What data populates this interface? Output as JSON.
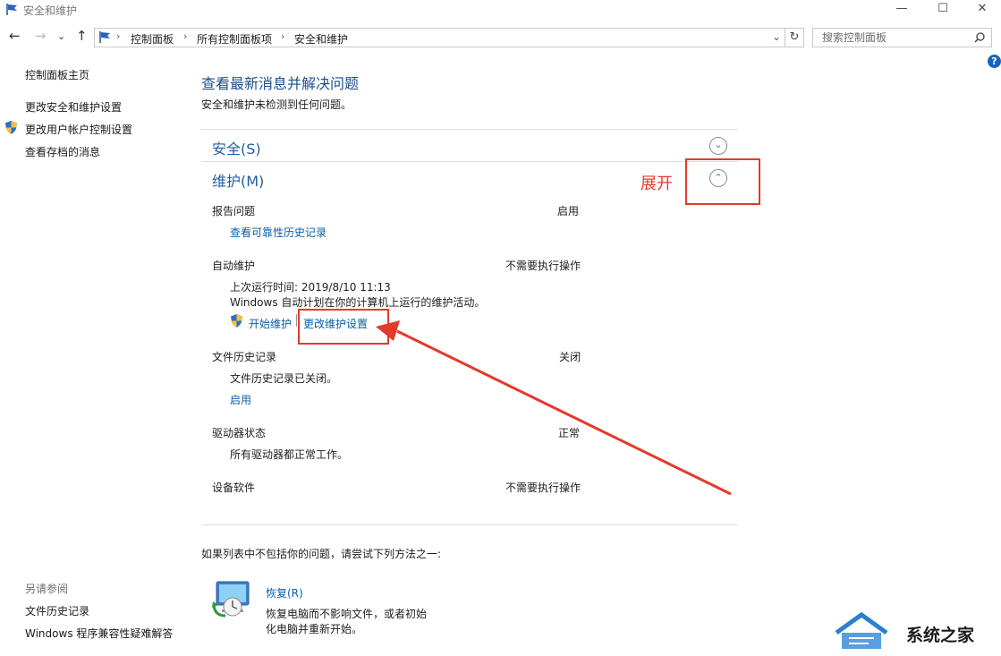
{
  "window": {
    "title": "安全和维护",
    "controls": {
      "minimize": "—",
      "maximize": "☐",
      "close": "✕"
    }
  },
  "nav": {
    "back": "←",
    "forward": "→",
    "recent": "⌄",
    "up": "↑"
  },
  "address": {
    "crumbs": [
      "控制面板",
      "所有控制面板项",
      "安全和维护"
    ],
    "dropdown": "⌄",
    "refresh": "↻"
  },
  "search": {
    "placeholder": "搜索控制面板",
    "value": ""
  },
  "help": "?",
  "sidebar": {
    "items": [
      {
        "label": "控制面板主页"
      },
      {
        "label": "更改安全和维护设置"
      },
      {
        "label": "更改用户帐户控制设置"
      },
      {
        "label": "查看存档的消息"
      }
    ],
    "see_also": {
      "title": "另请参阅",
      "items": [
        {
          "label": "文件历史记录"
        },
        {
          "label": "Windows 程序兼容性疑难解答"
        }
      ]
    }
  },
  "main": {
    "heading": "查看最新消息并解决问题",
    "subheading": "安全和维护未检测到任何问题。",
    "security": {
      "label": "安全(S)"
    },
    "maintenance": {
      "label": "维护(M)",
      "rows": {
        "report": {
          "label": "报告问题",
          "status": "启用",
          "link": "查看可靠性历史记录"
        },
        "auto": {
          "label": "自动维护",
          "status": "不需要执行操作",
          "last_run": "上次运行时间: 2019/8/10 11:13",
          "desc": "Windows 自动计划在你的计算机上运行的维护活动。",
          "start_link": "开始维护",
          "settings_link": "更改维护设置"
        },
        "file_history": {
          "label": "文件历史记录",
          "status": "关闭",
          "desc": "文件历史记录已关闭。",
          "link": "启用"
        },
        "drive": {
          "label": "驱动器状态",
          "status": "正常",
          "desc": "所有驱动器都正常工作。"
        },
        "device": {
          "label": "设备软件",
          "status": "不需要执行操作"
        }
      }
    },
    "footer_prompt": "如果列表中不包括你的问题，请尝试下列方法之一:",
    "recovery": {
      "link": "恢复(R)",
      "desc_line1": "恢复电脑而不影响文件，或者初始",
      "desc_line2": "化电脑并重新开始。"
    }
  },
  "annotation": {
    "expand_label": "展开"
  },
  "watermark": {
    "text": "系统之家"
  },
  "colors": {
    "link": "#0b5ea8",
    "section": "#1e5fa5",
    "annotation": "#e33a2c"
  }
}
